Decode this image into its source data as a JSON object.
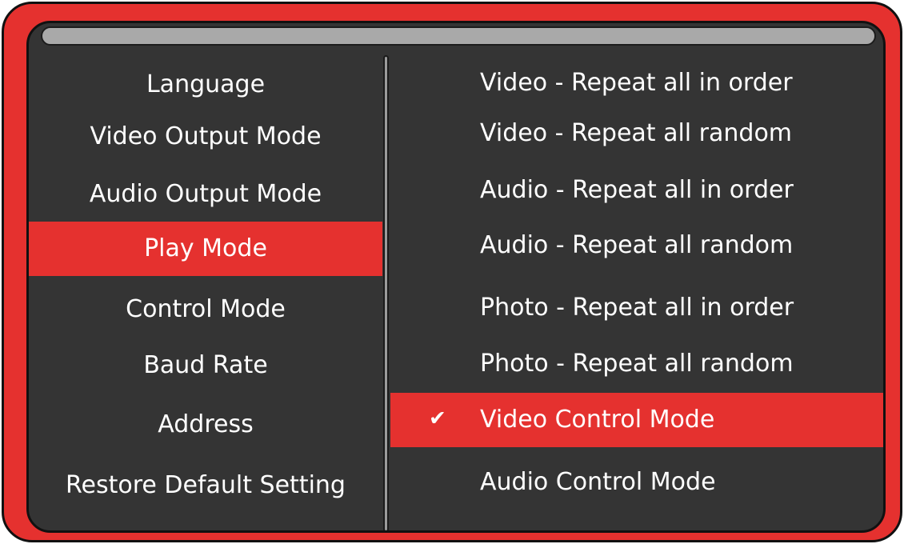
{
  "left_menu": {
    "items": [
      {
        "label": "Language"
      },
      {
        "label": "Video Output Mode"
      },
      {
        "label": "Audio Output Mode"
      },
      {
        "label": "Play Mode"
      },
      {
        "label": "Control Mode"
      },
      {
        "label": "Baud Rate"
      },
      {
        "label": "Address"
      },
      {
        "label": "Restore Default Setting"
      }
    ],
    "selected_index": 3
  },
  "right_menu": {
    "items": [
      {
        "label": "Video - Repeat all in order"
      },
      {
        "label": "Video - Repeat all random"
      },
      {
        "label": "Audio - Repeat all in order"
      },
      {
        "label": "Audio - Repeat all random"
      },
      {
        "label": "Photo - Repeat all in order"
      },
      {
        "label": "Photo - Repeat all random"
      },
      {
        "label": "Video Control Mode",
        "checked": true
      },
      {
        "label": "Audio Control Mode"
      }
    ],
    "selected_index": 6,
    "check_glyph": "✔"
  },
  "colors": {
    "frame": "#e5312f",
    "panel": "#343434",
    "highlight": "#e5312f",
    "text": "#ffffff",
    "titlebar": "#a9a9a9"
  },
  "icons": {
    "check": "checkmark-icon"
  }
}
